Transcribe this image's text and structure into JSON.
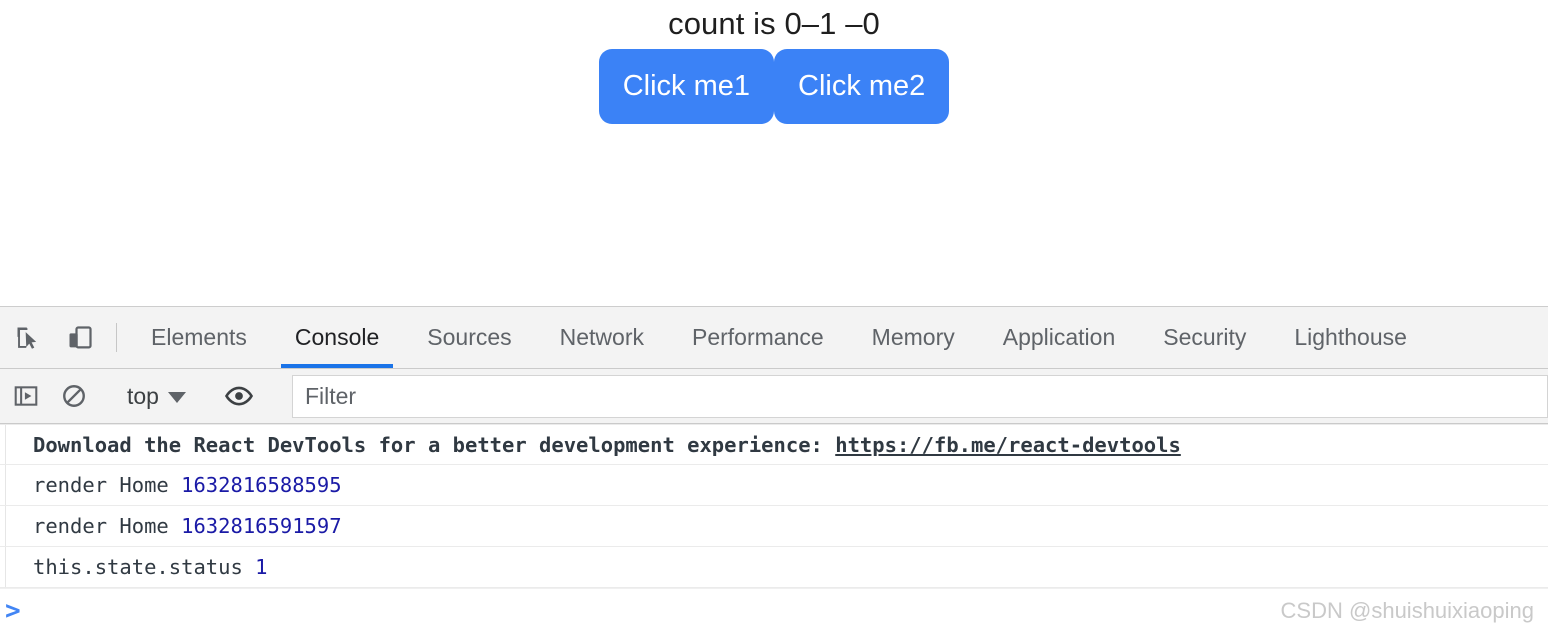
{
  "app": {
    "heading": "count is 0–1 –0",
    "buttons": [
      {
        "label": "Click me1",
        "name": "click-me1-button"
      },
      {
        "label": "Click me2",
        "name": "click-me2-button"
      }
    ],
    "accent_color": "#3b82f6"
  },
  "devtools": {
    "icons": {
      "inspect": "inspect-element-icon",
      "device": "device-toolbar-icon",
      "sidebar": "console-sidebar-icon",
      "clear": "clear-console-icon",
      "eye": "live-expression-eye-icon"
    },
    "tabs": [
      {
        "label": "Elements",
        "selected": false
      },
      {
        "label": "Console",
        "selected": true
      },
      {
        "label": "Sources",
        "selected": false
      },
      {
        "label": "Network",
        "selected": false
      },
      {
        "label": "Performance",
        "selected": false
      },
      {
        "label": "Memory",
        "selected": false
      },
      {
        "label": "Application",
        "selected": false
      },
      {
        "label": "Security",
        "selected": false
      },
      {
        "label": "Lighthouse",
        "selected": false
      }
    ],
    "selected_tab_underline_color": "#1a73e8",
    "console_toolbar": {
      "context_label": "top",
      "filter_placeholder": "Filter",
      "filter_value": ""
    },
    "console_messages": [
      {
        "type": "info-bold",
        "text": "Download the React DevTools for a better development experience: ",
        "link": "https://fb.me/react-devtools"
      },
      {
        "type": "log",
        "text": "render Home ",
        "value": "1632816588595"
      },
      {
        "type": "log",
        "text": "render Home ",
        "value": "1632816591597"
      },
      {
        "type": "log",
        "text": "this.state.status ",
        "value": "1"
      }
    ],
    "prompt_symbol": ">",
    "number_color": "#1a1aa6"
  },
  "watermark": "CSDN @shuishuixiaoping"
}
